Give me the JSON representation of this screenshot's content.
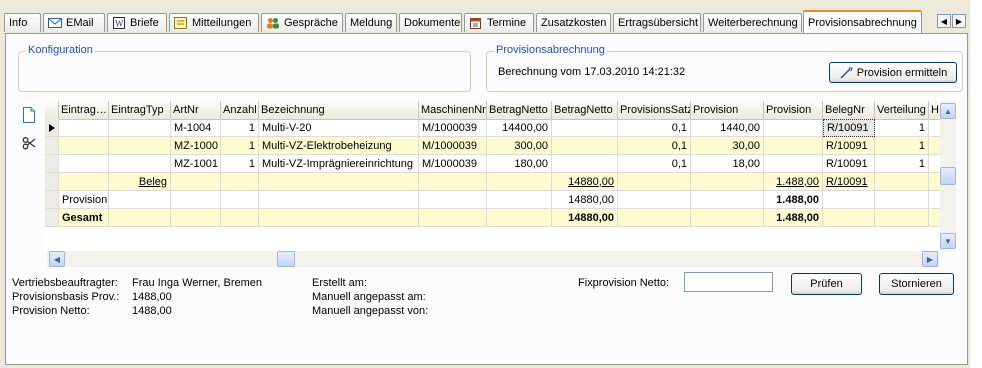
{
  "tabs": [
    {
      "label": "Info",
      "icon": "none"
    },
    {
      "label": "EMail",
      "icon": "email-icon"
    },
    {
      "label": "Briefe",
      "icon": "word-document-icon"
    },
    {
      "label": "Mitteilungen",
      "icon": "note-icon"
    },
    {
      "label": "Gespräche",
      "icon": "people-icon"
    },
    {
      "label": "Meldung",
      "icon": "none"
    },
    {
      "label": "Dokumente",
      "icon": "none"
    },
    {
      "label": "Termine",
      "icon": "calendar-icon"
    },
    {
      "label": "Zusatzkosten",
      "icon": "none"
    },
    {
      "label": "Ertragsübersicht",
      "icon": "none"
    },
    {
      "label": "Weiterberechnung",
      "icon": "none"
    },
    {
      "label": "Provisionsabrechnung",
      "icon": "none",
      "active": true
    }
  ],
  "config_group": {
    "title": "Konfiguration"
  },
  "provision_group": {
    "title": "Provisionsabrechnung",
    "calc_text": "Berechnung vom 17.03.2010 14:21:32",
    "button_label": "Provision ermitteln"
  },
  "grid": {
    "columns": [
      "Eintrag…",
      "EintragTyp",
      "ArtNr",
      "Anzahl",
      "Bezeichnung",
      "MaschinenNr",
      "BetragNetto",
      "BetragNetto",
      "ProvisionsSatz",
      "Provision",
      "Provision",
      "BelegNr",
      "Verteilung",
      "H"
    ],
    "rows": [
      [
        "",
        "",
        "M-1004",
        "1",
        "Multi-V-20",
        "M/1000039",
        "14400,00",
        "",
        "0,1",
        "1440,00",
        "",
        "R/10091",
        "1",
        ""
      ],
      [
        "",
        "",
        "MZ-1000",
        "1",
        "Multi-VZ-Elektrobeheizung",
        "M/1000039",
        "300,00",
        "",
        "0,1",
        "30,00",
        "",
        "R/10091",
        "1",
        ""
      ],
      [
        "",
        "",
        "MZ-1001",
        "1",
        "Multi-VZ-Imprägniereinrichtung",
        "M/1000039",
        "180,00",
        "",
        "0,1",
        "18,00",
        "",
        "R/10091",
        "1",
        ""
      ],
      [
        "",
        "Beleg",
        "",
        "",
        "",
        "",
        "",
        "14880,00",
        "",
        "",
        "1.488,00",
        "R/10091",
        "",
        ""
      ],
      [
        "Provision",
        "",
        "",
        "",
        "",
        "",
        "",
        "14880,00",
        "",
        "",
        "1.488,00",
        "",
        "",
        ""
      ],
      [
        "Gesamt",
        "",
        "",
        "",
        "",
        "",
        "",
        "14880,00",
        "",
        "",
        "1.488,00",
        "",
        "",
        ""
      ]
    ]
  },
  "footer": {
    "rep_label": "Vertriebsbeauftragter:",
    "rep_value": "Frau Inga Werner, Bremen",
    "basis_label": "Provisionsbasis Prov.:",
    "basis_value": "1488,00",
    "netto_label": "Provision Netto:",
    "netto_value": "1488,00",
    "created_label": "Erstellt am:",
    "modified_label": "Manuell angepasst am:",
    "modified_by_label": "Manuell angepasst von:",
    "fix_label": "Fixprovision Netto:",
    "fix_value": "",
    "check_button": "Prüfen",
    "cancel_button": "Stornieren"
  },
  "colors": {
    "accent_tab": "#e68b2c",
    "group_title": "#1f4fbf",
    "highlight_row": "#fefbd0"
  }
}
